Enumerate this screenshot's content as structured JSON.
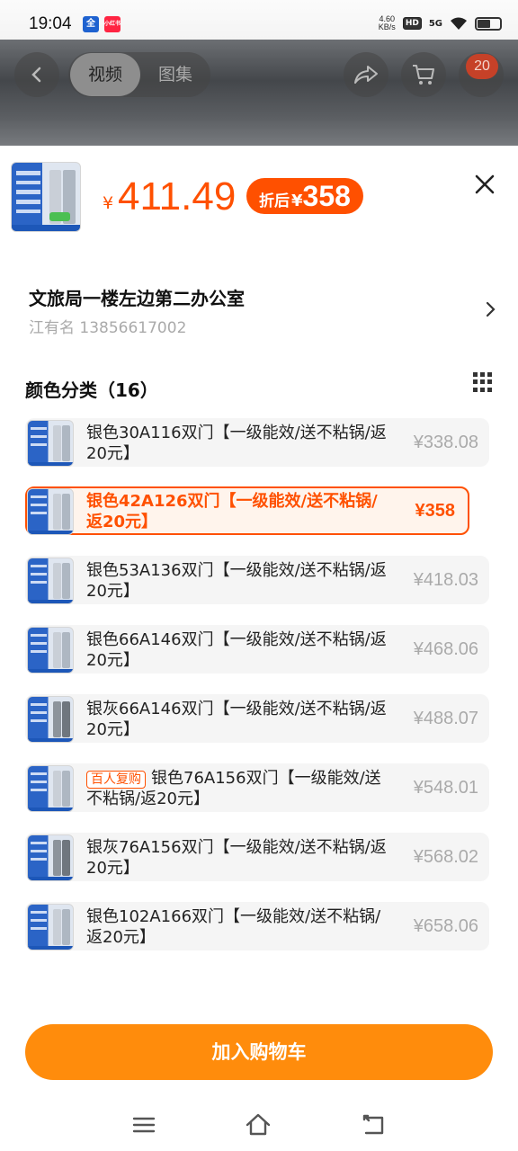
{
  "status_bar": {
    "time": "19:04",
    "net_speed_value": "4.60",
    "net_speed_unit": "KB/s",
    "hd": "HD",
    "network": "5G",
    "app_icon_1": "全",
    "app_icon_2": "小红书"
  },
  "header": {
    "tabs": [
      {
        "label": "视频",
        "active": true
      },
      {
        "label": "图集",
        "active": false
      }
    ],
    "cart_badge": "20"
  },
  "product": {
    "currency": "¥",
    "price": "411.49",
    "after_discount_label": "折后",
    "after_discount_currency": "¥",
    "after_discount_price": "358"
  },
  "address": {
    "title": "文旅局一楼左边第二办公室",
    "contact": "江有名 13856617002"
  },
  "section": {
    "title": "颜色分类（16）"
  },
  "options": [
    {
      "label": "银色30A116双门【一级能效/送不粘锅/返20元】",
      "price": "¥338.08",
      "selected": false,
      "tag": ""
    },
    {
      "label": "银色42A126双门【一级能效/送不粘锅/返20元】",
      "price": "¥358",
      "selected": true,
      "tag": ""
    },
    {
      "label": "银色53A136双门【一级能效/送不粘锅/返20元】",
      "price": "¥418.03",
      "selected": false,
      "tag": ""
    },
    {
      "label": "银色66A146双门【一级能效/送不粘锅/返20元】",
      "price": "¥468.06",
      "selected": false,
      "tag": ""
    },
    {
      "label": "银灰66A146双门【一级能效/送不粘锅/返20元】",
      "price": "¥488.07",
      "selected": false,
      "tag": ""
    },
    {
      "label": "银色76A156双门【一级能效/送不粘锅/返20元】",
      "price": "¥548.01",
      "selected": false,
      "tag": "百人复购"
    },
    {
      "label": "银灰76A156双门【一级能效/送不粘锅/返20元】",
      "price": "¥568.02",
      "selected": false,
      "tag": ""
    },
    {
      "label": "银色102A166双门【一级能效/送不粘锅/返20元】",
      "price": "¥658.06",
      "selected": false,
      "tag": ""
    }
  ],
  "actions": {
    "add_to_cart": "加入购物车"
  },
  "colors": {
    "accent": "#ff5000",
    "cart_button": "#ff8c0c"
  },
  "icons": [
    "back-icon",
    "share-icon",
    "cart-icon",
    "close-icon",
    "chevron-right-icon",
    "grid-view-icon",
    "menu-icon",
    "home-icon",
    "return-icon"
  ]
}
